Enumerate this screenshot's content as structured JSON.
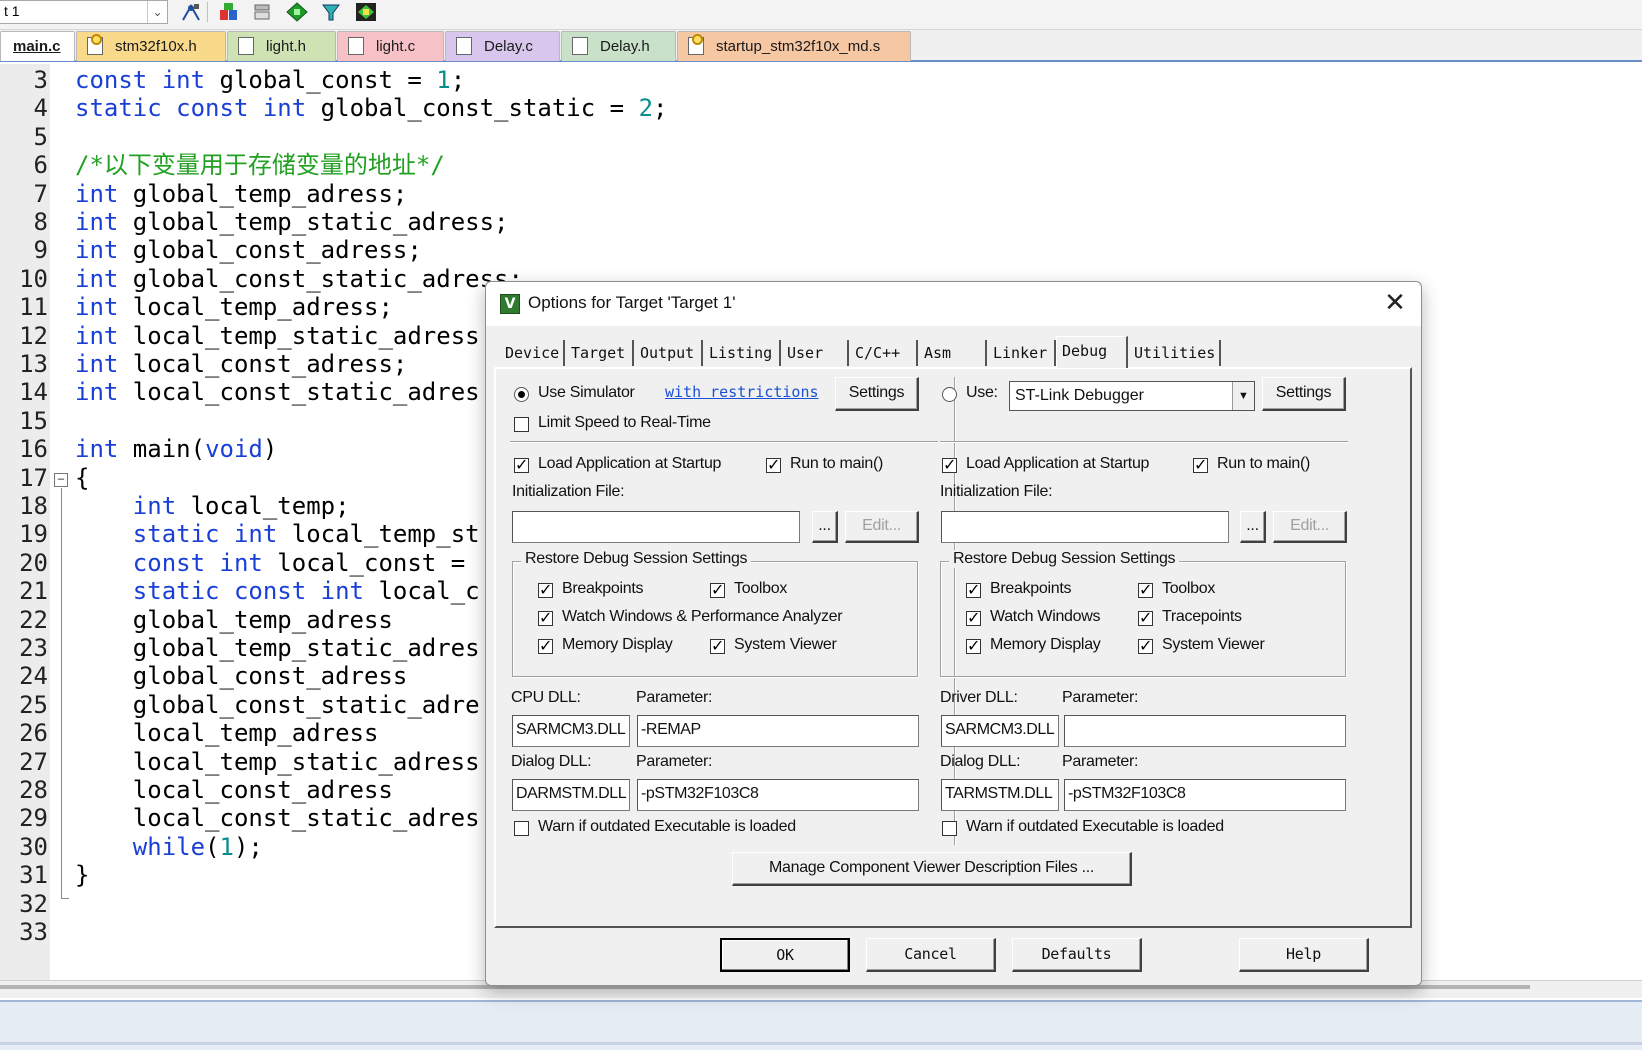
{
  "toolbar": {
    "target_combo": "t 1"
  },
  "file_tabs": [
    {
      "label": "main.c",
      "color": "#ffffff"
    },
    {
      "label": "stm32f10x.h",
      "color": "#f9d98a"
    },
    {
      "label": "light.h",
      "color": "#cfe2b4"
    },
    {
      "label": "light.c",
      "color": "#f7c1c8"
    },
    {
      "label": "Delay.c",
      "color": "#d8c6ec"
    },
    {
      "label": "Delay.h",
      "color": "#c9e0c9"
    },
    {
      "label": "startup_stm32f10x_md.s",
      "color": "#f6c7a3"
    }
  ],
  "editor": {
    "line_numbers": [
      "3",
      "4",
      "5",
      "6",
      "7",
      "8",
      "9",
      "10",
      "11",
      "12",
      "13",
      "14",
      "15",
      "16",
      "17",
      "18",
      "19",
      "20",
      "21",
      "22",
      "23",
      "24",
      "25",
      "26",
      "27",
      "28",
      "29",
      "30",
      "31",
      "32",
      "33"
    ],
    "lines": [
      [
        {
          "t": "const",
          "c": "kw"
        },
        {
          "t": " "
        },
        {
          "t": "int",
          "c": "kw"
        },
        {
          "t": " global_const = "
        },
        {
          "t": "1",
          "c": "num"
        },
        {
          "t": ";"
        }
      ],
      [
        {
          "t": "static",
          "c": "kw"
        },
        {
          "t": " "
        },
        {
          "t": "const",
          "c": "kw"
        },
        {
          "t": " "
        },
        {
          "t": "int",
          "c": "kw"
        },
        {
          "t": " global_const_static = "
        },
        {
          "t": "2",
          "c": "num"
        },
        {
          "t": ";"
        }
      ],
      [],
      [
        {
          "t": "/*以下变量用于存储变量的地址*/",
          "c": "cm"
        }
      ],
      [
        {
          "t": "int",
          "c": "kw"
        },
        {
          "t": " global_temp_adress;"
        }
      ],
      [
        {
          "t": "int",
          "c": "kw"
        },
        {
          "t": " global_temp_static_adress;"
        }
      ],
      [
        {
          "t": "int",
          "c": "kw"
        },
        {
          "t": " global_const_adress;"
        }
      ],
      [
        {
          "t": "int",
          "c": "kw"
        },
        {
          "t": " global_const_static_adress;"
        }
      ],
      [
        {
          "t": "int",
          "c": "kw"
        },
        {
          "t": " local_temp_adress;"
        }
      ],
      [
        {
          "t": "int",
          "c": "kw"
        },
        {
          "t": " local_temp_static_adress"
        }
      ],
      [
        {
          "t": "int",
          "c": "kw"
        },
        {
          "t": " local_const_adress;"
        }
      ],
      [
        {
          "t": "int",
          "c": "kw"
        },
        {
          "t": " local_const_static_adres"
        }
      ],
      [],
      [
        {
          "t": "int",
          "c": "kw"
        },
        {
          "t": " main("
        },
        {
          "t": "void",
          "c": "kw"
        },
        {
          "t": ")"
        }
      ],
      [
        {
          "t": "{"
        }
      ],
      [
        {
          "t": "    "
        },
        {
          "t": "int",
          "c": "kw"
        },
        {
          "t": " local_temp;"
        }
      ],
      [
        {
          "t": "    "
        },
        {
          "t": "static",
          "c": "kw"
        },
        {
          "t": " "
        },
        {
          "t": "int",
          "c": "kw"
        },
        {
          "t": " local_temp_st"
        }
      ],
      [
        {
          "t": "    "
        },
        {
          "t": "const",
          "c": "kw"
        },
        {
          "t": " "
        },
        {
          "t": "int",
          "c": "kw"
        },
        {
          "t": " local_const ="
        }
      ],
      [
        {
          "t": "    "
        },
        {
          "t": "static",
          "c": "kw"
        },
        {
          "t": " "
        },
        {
          "t": "const",
          "c": "kw"
        },
        {
          "t": " "
        },
        {
          "t": "int",
          "c": "kw"
        },
        {
          "t": " local_c"
        }
      ],
      [
        {
          "t": "    global_temp_adress"
        }
      ],
      [
        {
          "t": "    global_temp_static_adres"
        }
      ],
      [
        {
          "t": "    global_const_adress"
        }
      ],
      [
        {
          "t": "    global_const_static_adre"
        }
      ],
      [
        {
          "t": "    local_temp_adress"
        }
      ],
      [
        {
          "t": "    local_temp_static_adress"
        }
      ],
      [
        {
          "t": "    local_const_adress"
        }
      ],
      [
        {
          "t": "    local_const_static_adres"
        }
      ],
      [
        {
          "t": "    "
        },
        {
          "t": "while",
          "c": "kw"
        },
        {
          "t": "("
        },
        {
          "t": "1",
          "c": "num"
        },
        {
          "t": ");"
        }
      ],
      [
        {
          "t": "}"
        }
      ],
      [],
      []
    ]
  },
  "dialog": {
    "title": "Options for Target 'Target 1'",
    "tabs": [
      "Device",
      "Target",
      "Output",
      "Listing",
      "User",
      "C/C++",
      "Asm",
      "Linker",
      "Debug",
      "Utilities"
    ],
    "active_tab": "Debug",
    "left": {
      "use_simulator": "Use Simulator",
      "with_restrictions": "with restrictions",
      "settings": "Settings",
      "limit_speed": "Limit Speed to Real-Time",
      "load_app": "Load Application at Startup",
      "run_to_main": "Run to main()",
      "init_file_label": "Initialization File:",
      "init_file_value": "",
      "browse": "...",
      "edit": "Edit...",
      "restore_title": "Restore Debug Session Settings",
      "breakpoints": "Breakpoints",
      "toolbox": "Toolbox",
      "watch_windows": "Watch Windows & Performance Analyzer",
      "memory_display": "Memory Display",
      "system_viewer": "System Viewer",
      "cpu_dll_label": "CPU DLL:",
      "cpu_param_label": "Parameter:",
      "cpu_dll": "SARMCM3.DLL",
      "cpu_param": "-REMAP",
      "dialog_dll_label": "Dialog DLL:",
      "dialog_param_label": "Parameter:",
      "dialog_dll": "DARMSTM.DLL",
      "dialog_param": "-pSTM32F103C8",
      "warn": "Warn if outdated Executable is loaded"
    },
    "right": {
      "use": "Use:",
      "debugger": "ST-Link Debugger",
      "settings": "Settings",
      "load_app": "Load Application at Startup",
      "run_to_main": "Run to main()",
      "init_file_label": "Initialization File:",
      "init_file_value": "",
      "browse": "...",
      "edit": "Edit...",
      "restore_title": "Restore Debug Session Settings",
      "breakpoints": "Breakpoints",
      "toolbox": "Toolbox",
      "watch_windows": "Watch Windows",
      "tracepoints": "Tracepoints",
      "memory_display": "Memory Display",
      "system_viewer": "System Viewer",
      "driver_dll_label": "Driver DLL:",
      "driver_param_label": "Parameter:",
      "driver_dll": "SARMCM3.DLL",
      "driver_param": "",
      "dialog_dll_label": "Dialog DLL:",
      "dialog_param_label": "Parameter:",
      "dialog_dll": "TARMSTM.DLL",
      "dialog_param": "-pSTM32F103C8",
      "warn": "Warn if outdated Executable is loaded"
    },
    "manage_button": "Manage Component Viewer Description Files ...",
    "buttons": {
      "ok": "OK",
      "cancel": "Cancel",
      "defaults": "Defaults",
      "help": "Help"
    }
  }
}
